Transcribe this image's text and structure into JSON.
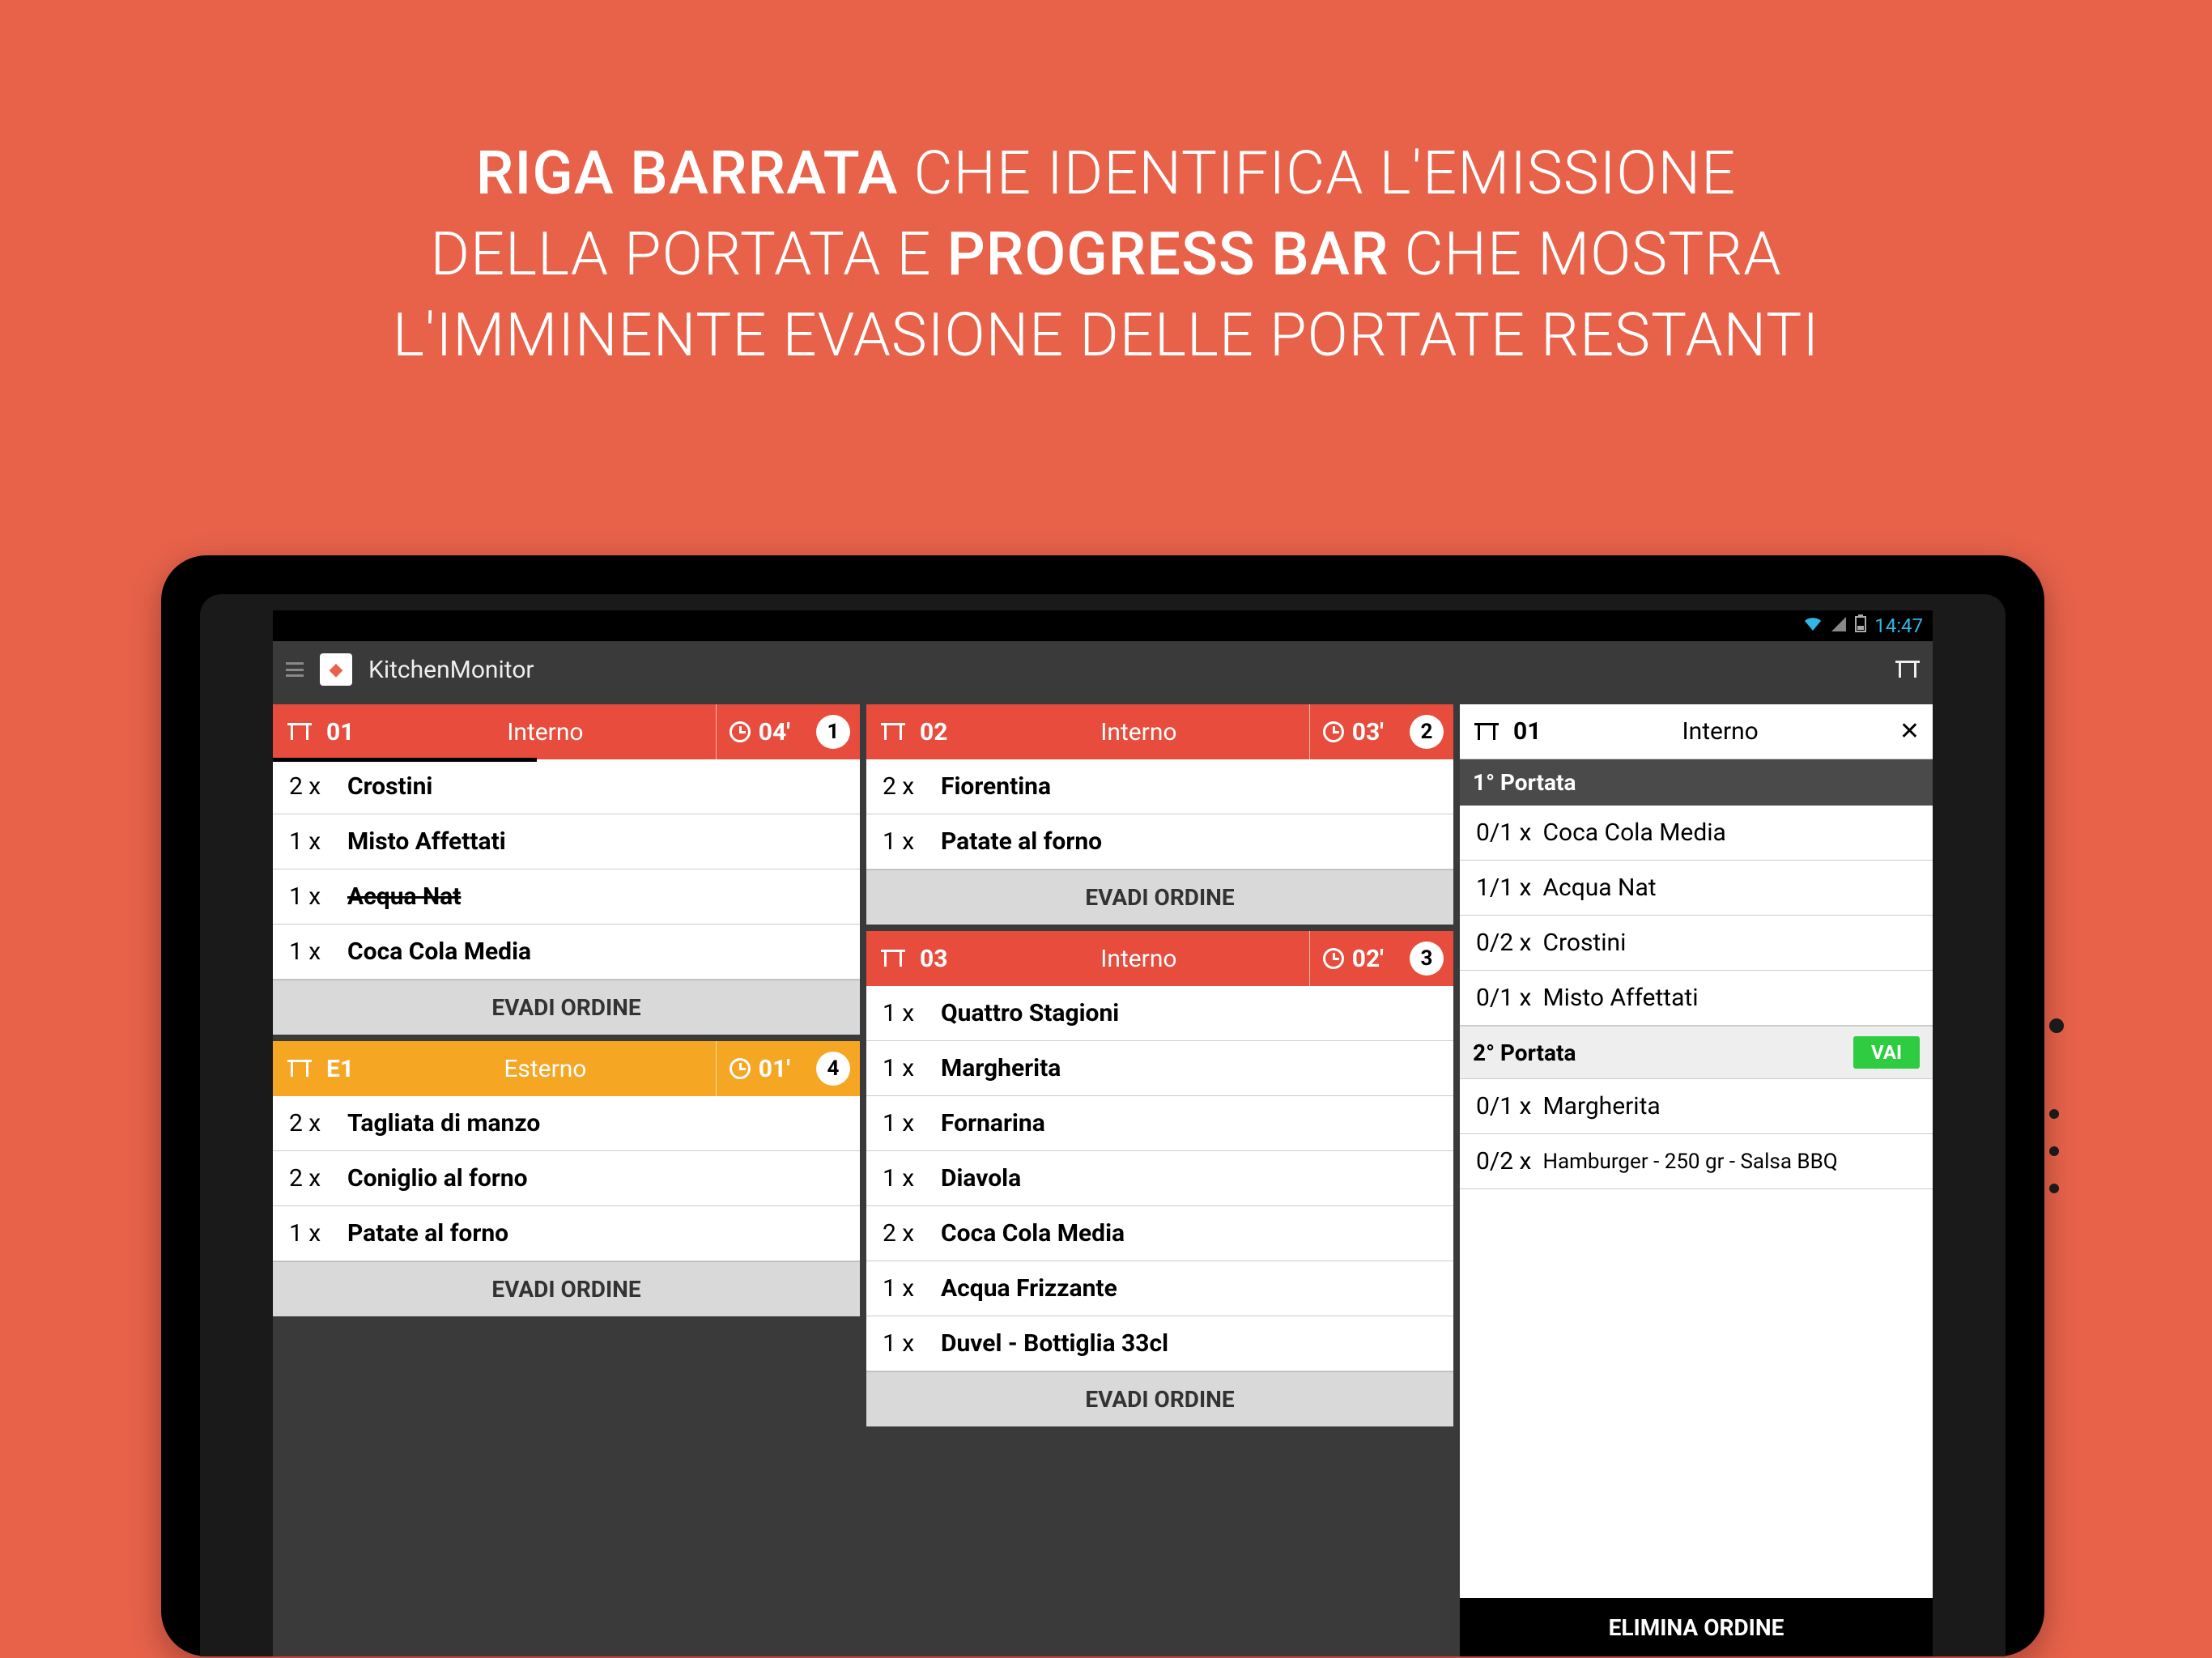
{
  "headline": {
    "b1": "RIGA BARRATA",
    "t1": "CHE IDENTIFICA L'EMISSIONE",
    "t2": "DELLA PORTATA E",
    "b2": "PROGRESS BAR",
    "t3": "CHE MOSTRA",
    "t4": "L'IMMINENTE EVASIONE DELLE PORTATE RESTANTI"
  },
  "statusbar": {
    "time": "14:47"
  },
  "appbar": {
    "title": "KitchenMonitor"
  },
  "labels": {
    "evadi": "EVADI ORDINE",
    "vai": "VAI",
    "elimina": "ELIMINA ORDINE"
  },
  "orders": [
    {
      "table": "01",
      "location": "Interno",
      "time": "04'",
      "badge": "1",
      "color": "red",
      "items": [
        {
          "qty": "2 x",
          "name": "Crostini"
        },
        {
          "qty": "1 x",
          "name": "Misto Affettati"
        },
        {
          "qty": "1 x",
          "name": "Acqua Nat",
          "struck": true
        },
        {
          "qty": "1 x",
          "name": "Coca Cola Media"
        }
      ]
    },
    {
      "table": "E1",
      "location": "Esterno",
      "time": "01'",
      "badge": "4",
      "color": "yellow",
      "items": [
        {
          "qty": "2 x",
          "name": "Tagliata di manzo"
        },
        {
          "qty": "2 x",
          "name": "Coniglio al forno"
        },
        {
          "qty": "1 x",
          "name": "Patate al forno"
        }
      ]
    },
    {
      "table": "02",
      "location": "Interno",
      "time": "03'",
      "badge": "2",
      "color": "red",
      "items": [
        {
          "qty": "2 x",
          "name": "Fiorentina"
        },
        {
          "qty": "1 x",
          "name": "Patate al forno"
        }
      ]
    },
    {
      "table": "03",
      "location": "Interno",
      "time": "02'",
      "badge": "3",
      "color": "red",
      "items": [
        {
          "qty": "1 x",
          "name": "Quattro Stagioni"
        },
        {
          "qty": "1 x",
          "name": "Margherita"
        },
        {
          "qty": "1 x",
          "name": "Fornarina"
        },
        {
          "qty": "1 x",
          "name": "Diavola"
        },
        {
          "qty": "2 x",
          "name": "Coca Cola Media"
        },
        {
          "qty": "1 x",
          "name": "Acqua Frizzante"
        },
        {
          "qty": "1 x",
          "name": "Duvel - Bottiglia 33cl"
        }
      ]
    }
  ],
  "detail": {
    "table": "01",
    "location": "Interno",
    "courses": [
      {
        "title": "1° Portata",
        "items": [
          {
            "qty": "0/1 x",
            "name": "Coca Cola Media"
          },
          {
            "qty": "1/1 x",
            "name": "Acqua Nat"
          },
          {
            "qty": "0/2 x",
            "name": "Crostini"
          },
          {
            "qty": "0/1 x",
            "name": "Misto Affettati"
          }
        ]
      },
      {
        "title": "2° Portata",
        "items": [
          {
            "qty": "0/1 x",
            "name": "Margherita"
          },
          {
            "qty": "0/2 x",
            "name": "Hamburger - 250 gr - Salsa BBQ"
          }
        ]
      }
    ]
  }
}
